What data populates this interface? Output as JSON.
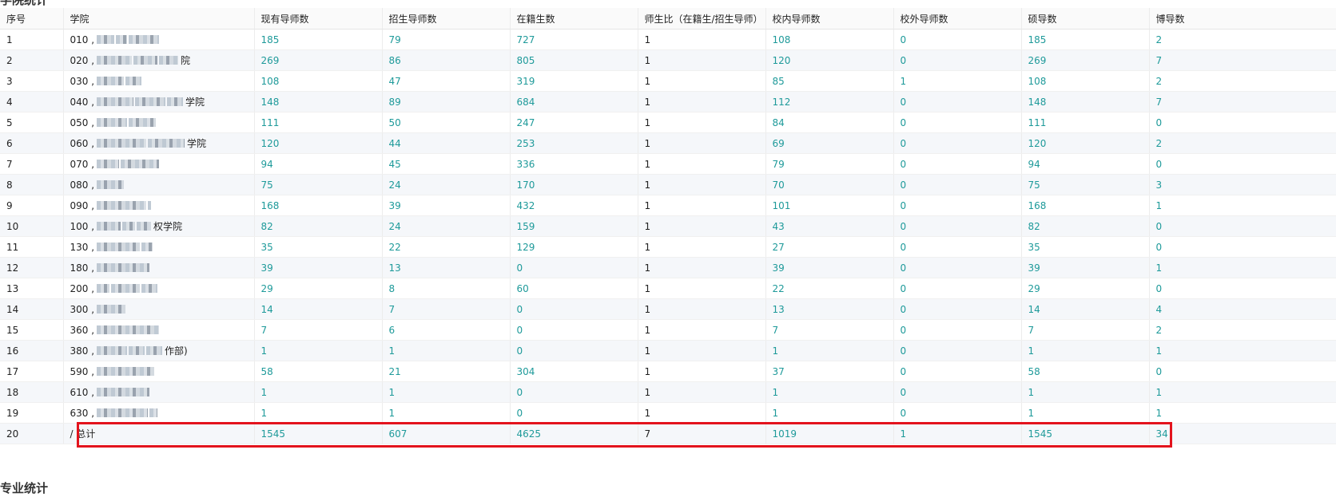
{
  "section_titles": {
    "college": "学院统计",
    "major": "专业统计"
  },
  "columns": [
    "序号",
    "学院",
    "现有导师数",
    "招生导师数",
    "在籍生数",
    "师生比（在籍生/招生导师）",
    "校内导师数",
    "校外导师数",
    "硕导数",
    "博导数"
  ],
  "rows": [
    {
      "index": "1",
      "code": "010 ,",
      "suffix": "",
      "current": "185",
      "enroll": "79",
      "students": "727",
      "ratio": "1",
      "internal": "108",
      "external": "0",
      "master": "185",
      "doctoral": "2"
    },
    {
      "index": "2",
      "code": "020 ,",
      "suffix": "院",
      "current": "269",
      "enroll": "86",
      "students": "805",
      "ratio": "1",
      "internal": "120",
      "external": "0",
      "master": "269",
      "doctoral": "7"
    },
    {
      "index": "3",
      "code": "030 ,",
      "suffix": "",
      "current": "108",
      "enroll": "47",
      "students": "319",
      "ratio": "1",
      "internal": "85",
      "external": "1",
      "master": "108",
      "doctoral": "2"
    },
    {
      "index": "4",
      "code": "040 ,",
      "suffix": "学院",
      "current": "148",
      "enroll": "89",
      "students": "684",
      "ratio": "1",
      "internal": "112",
      "external": "0",
      "master": "148",
      "doctoral": "7"
    },
    {
      "index": "5",
      "code": "050 ,",
      "suffix": "",
      "current": "111",
      "enroll": "50",
      "students": "247",
      "ratio": "1",
      "internal": "84",
      "external": "0",
      "master": "111",
      "doctoral": "0"
    },
    {
      "index": "6",
      "code": "060 ,",
      "suffix": "学院",
      "current": "120",
      "enroll": "44",
      "students": "253",
      "ratio": "1",
      "internal": "69",
      "external": "0",
      "master": "120",
      "doctoral": "2"
    },
    {
      "index": "7",
      "code": "070 ,",
      "suffix": "",
      "current": "94",
      "enroll": "45",
      "students": "336",
      "ratio": "1",
      "internal": "79",
      "external": "0",
      "master": "94",
      "doctoral": "0"
    },
    {
      "index": "8",
      "code": "080 ,",
      "suffix": "",
      "current": "75",
      "enroll": "24",
      "students": "170",
      "ratio": "1",
      "internal": "70",
      "external": "0",
      "master": "75",
      "doctoral": "3"
    },
    {
      "index": "9",
      "code": "090 ,",
      "suffix": "",
      "current": "168",
      "enroll": "39",
      "students": "432",
      "ratio": "1",
      "internal": "101",
      "external": "0",
      "master": "168",
      "doctoral": "1"
    },
    {
      "index": "10",
      "code": "100 ,",
      "suffix": "权学院",
      "current": "82",
      "enroll": "24",
      "students": "159",
      "ratio": "1",
      "internal": "43",
      "external": "0",
      "master": "82",
      "doctoral": "0"
    },
    {
      "index": "11",
      "code": "130 ,",
      "suffix": "",
      "current": "35",
      "enroll": "22",
      "students": "129",
      "ratio": "1",
      "internal": "27",
      "external": "0",
      "master": "35",
      "doctoral": "0"
    },
    {
      "index": "12",
      "code": "180 ,",
      "suffix": "",
      "current": "39",
      "enroll": "13",
      "students": "0",
      "ratio": "1",
      "internal": "39",
      "external": "0",
      "master": "39",
      "doctoral": "1"
    },
    {
      "index": "13",
      "code": "200 ,",
      "suffix": "",
      "current": "29",
      "enroll": "8",
      "students": "60",
      "ratio": "1",
      "internal": "22",
      "external": "0",
      "master": "29",
      "doctoral": "0"
    },
    {
      "index": "14",
      "code": "300 ,",
      "suffix": "",
      "current": "14",
      "enroll": "7",
      "students": "0",
      "ratio": "1",
      "internal": "13",
      "external": "0",
      "master": "14",
      "doctoral": "4"
    },
    {
      "index": "15",
      "code": "360 ,",
      "suffix": "",
      "current": "7",
      "enroll": "6",
      "students": "0",
      "ratio": "1",
      "internal": "7",
      "external": "0",
      "master": "7",
      "doctoral": "2"
    },
    {
      "index": "16",
      "code": "380 ,",
      "suffix": "作部)",
      "current": "1",
      "enroll": "1",
      "students": "0",
      "ratio": "1",
      "internal": "1",
      "external": "0",
      "master": "1",
      "doctoral": "1"
    },
    {
      "index": "17",
      "code": "590 ,",
      "suffix": "",
      "current": "58",
      "enroll": "21",
      "students": "304",
      "ratio": "1",
      "internal": "37",
      "external": "0",
      "master": "58",
      "doctoral": "0"
    },
    {
      "index": "18",
      "code": "610 ,",
      "suffix": "",
      "current": "1",
      "enroll": "1",
      "students": "0",
      "ratio": "1",
      "internal": "1",
      "external": "0",
      "master": "1",
      "doctoral": "1"
    },
    {
      "index": "19",
      "code": "630 ,",
      "suffix": "",
      "current": "1",
      "enroll": "1",
      "students": "0",
      "ratio": "1",
      "internal": "1",
      "external": "0",
      "master": "1",
      "doctoral": "1"
    }
  ],
  "total_row": {
    "index": "20",
    "college": "/ 总计",
    "current": "1545",
    "enroll": "607",
    "students": "4625",
    "ratio": "7",
    "internal": "1019",
    "external": "1",
    "master": "1545",
    "doctoral": "34"
  },
  "colors": {
    "number": "#1e9a9a",
    "highlight": "#e3131d",
    "stripe": "#f5f7fa"
  }
}
